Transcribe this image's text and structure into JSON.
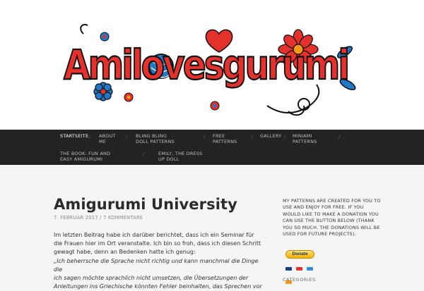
{
  "site": {
    "logo_text": "Amilovesgurumi",
    "colors": {
      "red": "#e5312b",
      "blue": "#1f78c8",
      "black": "#111111",
      "orange": "#f39a1a"
    }
  },
  "nav": {
    "items": [
      {
        "label": "STARTSEITE",
        "active": true
      },
      {
        "label": "ABOUT ME"
      },
      {
        "label": "BLING BLING DOLL PATTERNS"
      },
      {
        "label": "FREE PATTERNS"
      },
      {
        "label": "GALLERY"
      },
      {
        "label": "MINIAMI PATTERNS"
      },
      {
        "label": "THE BOOK: FUN AND EASY AMIGURUMI"
      },
      {
        "label": "EMILY, THE DRESS UP DOLL"
      }
    ],
    "separator": "/"
  },
  "post": {
    "title": "Amigurumi University",
    "date": "7. Februar 2017",
    "meta_sep": "/",
    "comments": "7 Kommentare",
    "paragraph": "Im letzten Beitrag habe ich darüber berichtet, dass ich ein Seminar für die Frauen hier im Ort veranstalte. Ich bin so froh, dass ich diesen Schritt gewagt habe, denn an Bedenken hatte ich genug:",
    "quote_line1": "„Ich beherrsche die Sprache nicht richtig und kann manchmal die Dinge die",
    "quote_line2": "ich sagen möchte sprachlich nicht umsetzen, die Übersetzungen der",
    "quote_line3": "Anleitungen ins Griechische könnten Fehler beinhalten, das Sprechen vor"
  },
  "sidebar": {
    "donation_text": "My patterns are created for you to use and enjoy for free. If you would like to make a donation you can use the button below (thank you so much, the donations will be used for future projects).",
    "donate_label": "Donate",
    "categories_heading": "Categories"
  }
}
